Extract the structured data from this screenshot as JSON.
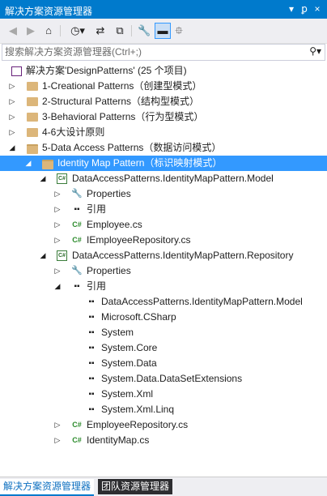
{
  "window": {
    "title": "解决方案资源管理器",
    "dropdown_icon": "▾",
    "pin_icon": "ꝑ",
    "close_icon": "×"
  },
  "toolbar": {
    "back_glyph": "◀",
    "forward_glyph": "▶",
    "home_glyph": "⌂",
    "history_glyph": "◷▾",
    "sync_glyph": "⇄",
    "collapse_glyph": "⧉",
    "properties_glyph": "🔧",
    "preview_glyph": "▬",
    "view_glyph": "⯐"
  },
  "search": {
    "placeholder": "搜索解决方案资源管理器(Ctrl+;)",
    "button_glyph": "⚲▾"
  },
  "tree": {
    "solution": "解决方案'DesignPatterns' (25 个项目)",
    "folders": [
      "1-Creational Patterns（创建型模式）",
      "2-Structural Patterns（结构型模式）",
      "3-Behavioral Patterns（行为型模式）",
      "4-6大设计原则",
      "5-Data Access Patterns（数据访问模式）"
    ],
    "selected_folder": "Identity Map Pattern（标识映射模式）",
    "model_project": {
      "name": "DataAccessPatterns.IdentityMapPattern.Model",
      "items": [
        "Properties",
        "引用",
        "Employee.cs",
        "IEmployeeRepository.cs"
      ]
    },
    "repository_project": {
      "name": "DataAccessPatterns.IdentityMapPattern.Repository",
      "properties": "Properties",
      "references_label": "引用",
      "references": [
        "DataAccessPatterns.IdentityMapPattern.Model",
        "Microsoft.CSharp",
        "System",
        "System.Core",
        "System.Data",
        "System.Data.DataSetExtensions",
        "System.Xml",
        "System.Xml.Linq"
      ],
      "files": [
        "EmployeeRepository.cs",
        "IdentityMap.cs"
      ]
    },
    "glyphs": {
      "collapsed": "▷",
      "expanded": "◢",
      "cs": "C#",
      "ref": "▪▪",
      "wrench": "🔧"
    }
  },
  "bottom_tabs": [
    "解决方案资源管理器",
    "团队资源管理器"
  ],
  "colors": {
    "accent": "#007acc",
    "selection": "#3399ff",
    "folder": "#dcb67a"
  }
}
